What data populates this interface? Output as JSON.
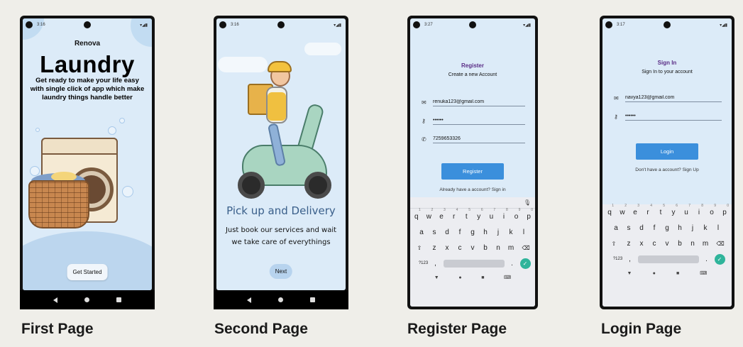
{
  "pages": [
    {
      "caption": "First Page",
      "status_time": "3:16",
      "brand": "Renova",
      "title": "Laundry",
      "description": "Get ready to make your life easy with single click of app which make laundry things handle better",
      "button": "Get Started"
    },
    {
      "caption": "Second Page",
      "status_time": "3:16",
      "heading": "Pick up and Delivery",
      "description": "Just book our services and wait we take care of everythings",
      "button": "Next"
    },
    {
      "caption": "Register Page",
      "status_time": "3:27",
      "title": "Register",
      "subtitle": "Create a new Account",
      "email": "renuka123@gmail.com",
      "password": "••••••",
      "phone": "7259653326",
      "button": "Register",
      "link": "Already have a account? Sign in"
    },
    {
      "caption": "Login Page",
      "status_time": "3:17",
      "title": "Sign In",
      "subtitle": "Sign In to your account",
      "email": "navya123@gmail.com",
      "password": "••••••",
      "button": "Login",
      "link": "Don't have a account? Sign Up"
    }
  ],
  "keyboard": {
    "row1": [
      "q",
      "w",
      "e",
      "r",
      "t",
      "y",
      "u",
      "i",
      "o",
      "p"
    ],
    "row1_nums": [
      "1",
      "2",
      "3",
      "4",
      "5",
      "6",
      "7",
      "8",
      "9",
      "0"
    ],
    "row2": [
      "a",
      "s",
      "d",
      "f",
      "g",
      "h",
      "j",
      "k",
      "l"
    ],
    "row3": [
      "z",
      "x",
      "c",
      "v",
      "b",
      "n",
      "m"
    ],
    "symbols_key": "?123",
    "comma": ",",
    "period": "."
  },
  "colors": {
    "background": "#efeee9",
    "screen": "#dcebf8",
    "primary_button": "#3b8fdc",
    "form_title": "#5a2d86",
    "enter_key": "#2fb49b"
  },
  "icons": [
    "email-icon",
    "key-icon",
    "phone-icon",
    "mic-icon",
    "back-icon",
    "home-icon",
    "recent-apps-icon"
  ]
}
